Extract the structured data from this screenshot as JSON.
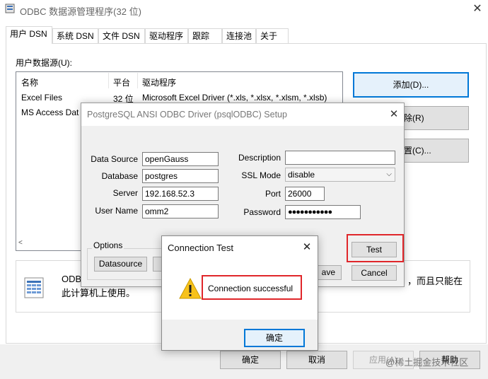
{
  "main": {
    "title": "ODBC 数据源管理程序(32 位)",
    "tabs": [
      "用户 DSN",
      "系统 DSN",
      "文件 DSN",
      "驱动程序",
      "跟踪",
      "连接池",
      "关于"
    ],
    "user_ds_label": "用户数据源(U):",
    "columns": [
      "名称",
      "平台",
      "驱动程序"
    ],
    "rows": [
      {
        "name": "Excel Files",
        "platform": "32 位",
        "driver": "Microsoft Excel Driver (*.xls, *.xlsx, *.xlsm, *.xlsb)"
      },
      {
        "name": "MS Access Dat",
        "platform": "",
        "driver": ""
      }
    ],
    "add_button": "添加(D)...",
    "remove_button_partial": "除(R)",
    "config_button_partial": "置(C)...",
    "info_text_1": "ODB",
    "info_text_2": "，而且只能在",
    "info_text_3": "此计算机上使用。",
    "ok": "确定",
    "cancel": "取消",
    "apply": "应用(A)",
    "help": "帮助",
    "watermark": "@稀土掘金技术社区"
  },
  "setup": {
    "title": "PostgreSQL ANSI ODBC Driver (psqlODBC) Setup",
    "data_source_label": "Data Source",
    "data_source_value": "openGauss",
    "database_label": "Database",
    "database_value": "postgres",
    "server_label": "Server",
    "server_value": "192.168.52.3",
    "user_name_label": "User Name",
    "user_name_value": "omm2",
    "description_label": "Description",
    "description_value": "",
    "ssl_mode_label": "SSL Mode",
    "ssl_mode_value": "disable",
    "port_label": "Port",
    "port_value": "26000",
    "password_label": "Password",
    "password_value": "●●●●●●●●●●●",
    "options_label": "Options",
    "datasource_button": "Datasource",
    "save_partial": "ave",
    "test_button": "Test",
    "cancel_button": "Cancel"
  },
  "conn_test": {
    "title": "Connection Test",
    "message": "Connection successful",
    "ok": "确定"
  }
}
